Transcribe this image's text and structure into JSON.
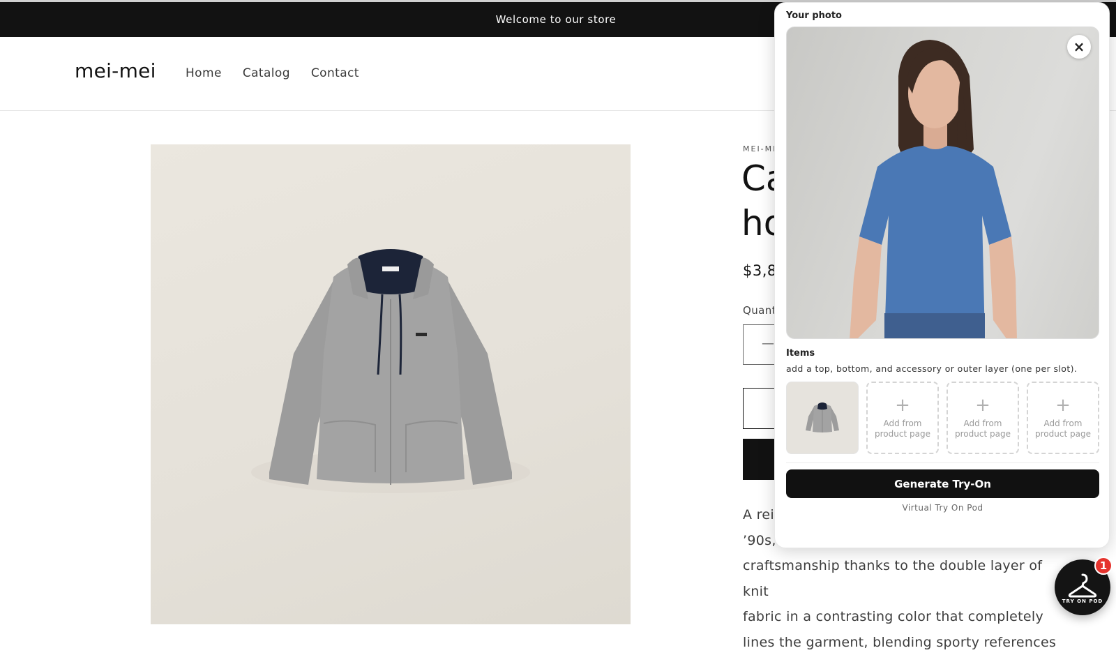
{
  "announcement": {
    "text": "Welcome to our store"
  },
  "header": {
    "logo": "mei-mei",
    "nav": [
      "Home",
      "Catalog",
      "Contact"
    ]
  },
  "product": {
    "vendor": "MEI-ME",
    "title_line1": "Ca",
    "title_line2": "ho",
    "price": "$3,8",
    "quantity_label": "Quant",
    "quantity_minus": "—",
    "description": [
      "A rei",
      "’90s,",
      "craftsmanship thanks to the double layer of knit",
      "fabric in a contrasting color that completely",
      "lines the garment, blending sporty references"
    ]
  },
  "tryon_panel": {
    "photo_label": "Your photo",
    "close_icon": "×",
    "items_title": "Items",
    "items_hint": "add a top, bottom, and accessory or outer layer (one per slot).",
    "slots": [
      {
        "filled": true
      },
      {
        "filled": false,
        "plus": "+",
        "label_1": "Add from",
        "label_2": "product page"
      },
      {
        "filled": false,
        "plus": "+",
        "label_1": "Add from",
        "label_2": "product page"
      },
      {
        "filled": false,
        "plus": "+",
        "label_1": "Add from",
        "label_2": "product page"
      }
    ],
    "generate_button": "Generate Try-On",
    "powered_by": "Virtual Try On Pod"
  },
  "launcher": {
    "text": "TRY ON POD",
    "badge_count": "1"
  },
  "colors": {
    "accent": "#121212",
    "badge": "#e5342e",
    "hoodie": "#9e9e9e",
    "hood_lining": "#1c2438",
    "tshirt": "#4a78b5"
  }
}
